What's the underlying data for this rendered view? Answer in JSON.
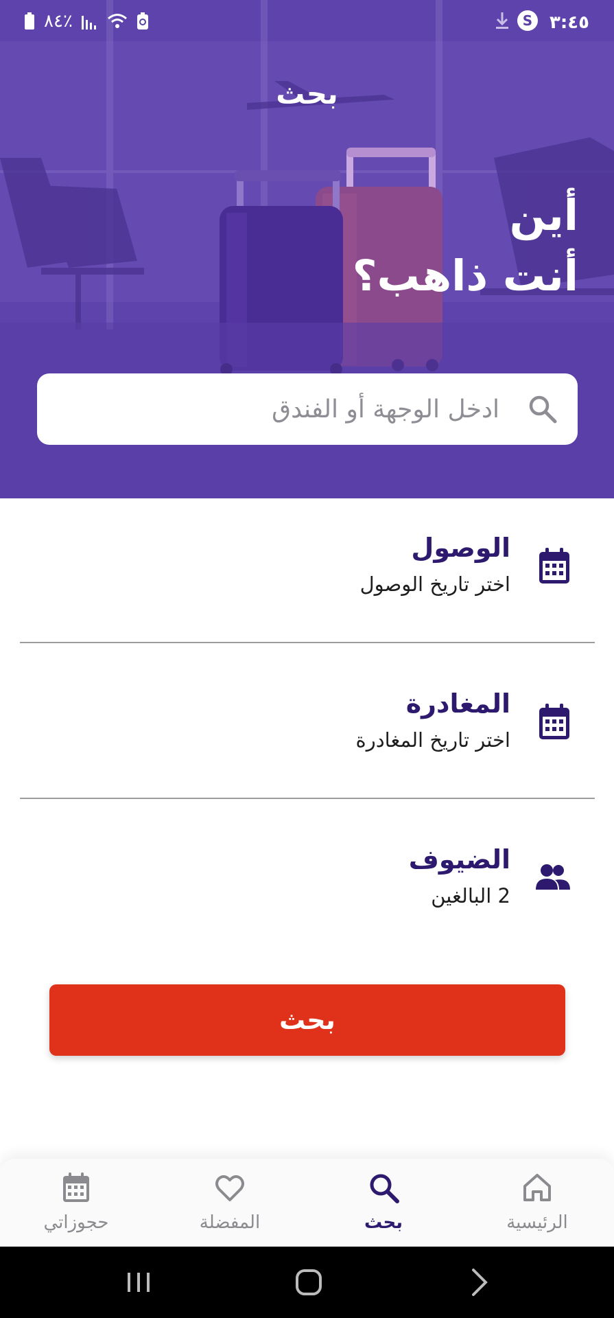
{
  "status_bar": {
    "time": "٣:٤٥",
    "battery": "٨٤٪",
    "icons": [
      "download-icon",
      "s-app-icon",
      "battery-icon",
      "signal-icon",
      "wifi-icon",
      "battery-saver-icon"
    ]
  },
  "header": {
    "title": "بحث",
    "headline_line1": "أين",
    "headline_line2": "أنت ذاهب؟"
  },
  "search": {
    "placeholder": "ادخل الوجهة أو الفندق",
    "icon": "search-icon"
  },
  "fields": [
    {
      "label": "الوصول",
      "value": "اختر تاريخ الوصول",
      "icon": "calendar-icon"
    },
    {
      "label": "المغادرة",
      "value": "اختر تاريخ المغادرة",
      "icon": "calendar-icon"
    },
    {
      "label": "الضيوف",
      "value": "2 البالغين",
      "icon": "people-icon"
    }
  ],
  "search_button": {
    "label": "بحث"
  },
  "bottom_nav": {
    "items": [
      {
        "label": "الرئيسية",
        "icon": "home-icon",
        "active": false
      },
      {
        "label": "بحث",
        "icon": "search-icon",
        "active": true
      },
      {
        "label": "المفضلة",
        "icon": "heart-icon",
        "active": false
      },
      {
        "label": "حجوزاتي",
        "icon": "calendar-icon",
        "active": false
      }
    ]
  },
  "colors": {
    "primary": "#5b40a8",
    "dark_purple": "#2d1a6e",
    "accent": "#e0311a",
    "nav_inactive": "#8a8a8f"
  }
}
